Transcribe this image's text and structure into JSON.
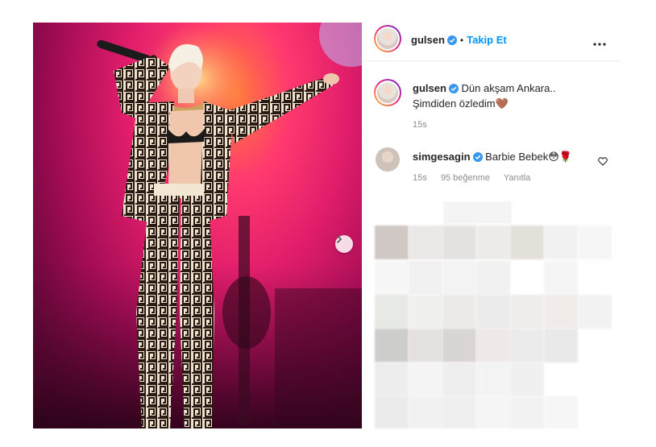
{
  "post": {
    "author": "gulsen",
    "follow_label": "Takip Et",
    "separator": "•"
  },
  "caption": {
    "author": "gulsen",
    "line1": "Dün akşam Ankara..",
    "line2": "Şimdiden özledim",
    "emoji": "🤎",
    "time": "15s"
  },
  "comments": [
    {
      "author": "simgesagin",
      "text": "Barbie Bebek",
      "emoji": "😳🌹",
      "time": "15s",
      "likes": "95 beğenme",
      "reply": "Yanıtla"
    }
  ],
  "colors": {
    "accent": "#0095f6",
    "verified": "#3897f0",
    "meta": "#8e8e8e"
  },
  "icons": [
    "verified-badge-icon",
    "more-options-icon",
    "heart-outline-icon",
    "chevron-right-icon"
  ]
}
